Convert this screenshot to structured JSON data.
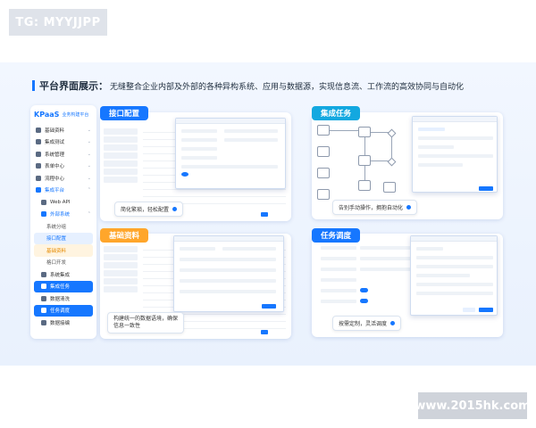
{
  "watermarks": {
    "top": "TG: MYYJJPP",
    "bottom": "www.2015hk.com"
  },
  "headline": {
    "title": "平台界面展示：",
    "subtitle": "无缝整合企业内部及外部的各种异构系统、应用与数据源，实现信息流、工作流的高效协同与自动化"
  },
  "sidebar": {
    "logo": "KPaaS",
    "logo_sub": "业务构建平台",
    "items": [
      {
        "label": "基础资料",
        "icon": "database-icon"
      },
      {
        "label": "集成测试",
        "icon": "test-icon"
      },
      {
        "label": "系统管理",
        "icon": "settings-icon"
      },
      {
        "label": "表单中心",
        "icon": "form-icon"
      },
      {
        "label": "流程中心",
        "icon": "flow-icon"
      },
      {
        "label": "集成平台",
        "icon": "integration-icon"
      },
      {
        "label": "Web API",
        "icon": "api-icon"
      },
      {
        "label": "外部系统",
        "icon": "external-icon"
      },
      {
        "label": "系统分组",
        "icon": ""
      },
      {
        "label": "接口配置",
        "icon": ""
      },
      {
        "label": "基础资料",
        "icon": ""
      },
      {
        "label": "格口开发",
        "icon": ""
      },
      {
        "label": "系统集成",
        "icon": "system-icon"
      },
      {
        "label": "集成任务",
        "icon": "task-icon"
      },
      {
        "label": "数据清洗",
        "icon": "clean-icon"
      },
      {
        "label": "任务调度",
        "icon": "schedule-icon"
      },
      {
        "label": "数据接编",
        "icon": "data-icon"
      }
    ]
  },
  "cards": {
    "interface": {
      "tag": "接口配置",
      "note": "简化繁琐，轻松配置"
    },
    "integration": {
      "tag": "集成任务",
      "note": "告别手动操作，拥抱自动化"
    },
    "basic": {
      "tag": "基础资料",
      "note": "构建统一的数据语境，确保信息一致性"
    },
    "schedule": {
      "tag": "任务调度",
      "note": "按需定制，灵活调度"
    }
  },
  "colors": {
    "primary": "#1677ff",
    "orange": "#ffa62b",
    "cyan": "#13a8e0"
  }
}
